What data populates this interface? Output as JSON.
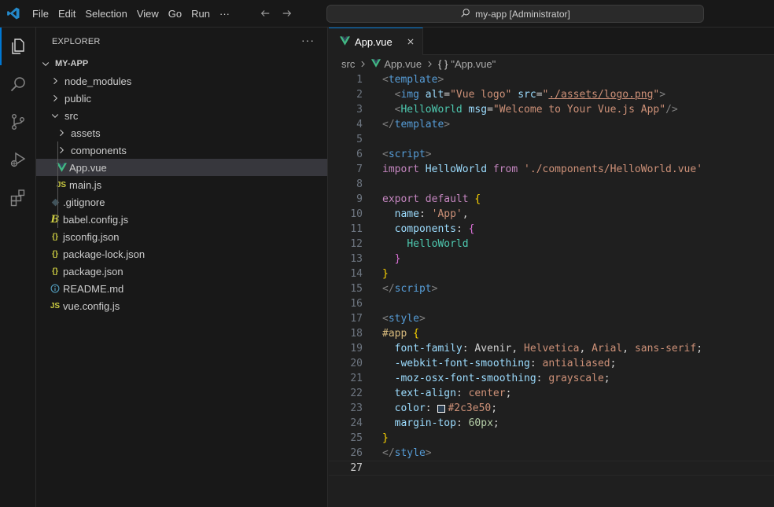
{
  "titlebar": {
    "menu": [
      "File",
      "Edit",
      "Selection",
      "View",
      "Go",
      "Run"
    ],
    "more": "···",
    "command_center": "my-app [Administrator]"
  },
  "sidebar": {
    "title": "EXPLORER",
    "more": "···",
    "project": "MY-APP",
    "items": [
      {
        "label": "node_modules",
        "type": "folder"
      },
      {
        "label": "public",
        "type": "folder"
      },
      {
        "label": "src",
        "type": "folder-open"
      },
      {
        "label": "assets",
        "type": "folder"
      },
      {
        "label": "components",
        "type": "folder"
      },
      {
        "label": "App.vue",
        "type": "vue"
      },
      {
        "label": "main.js",
        "type": "js"
      },
      {
        "label": ".gitignore",
        "type": "git"
      },
      {
        "label": "babel.config.js",
        "type": "babel"
      },
      {
        "label": "jsconfig.json",
        "type": "json"
      },
      {
        "label": "package-lock.json",
        "type": "json"
      },
      {
        "label": "package.json",
        "type": "json"
      },
      {
        "label": "README.md",
        "type": "info"
      },
      {
        "label": "vue.config.js",
        "type": "js"
      }
    ]
  },
  "editor": {
    "tab": "App.vue",
    "breadcrumb": [
      "src",
      "App.vue",
      "\"App.vue\""
    ],
    "line_numbers": [
      "1",
      "2",
      "3",
      "4",
      "5",
      "6",
      "7",
      "8",
      "9",
      "10",
      "11",
      "12",
      "13",
      "14",
      "15",
      "16",
      "17",
      "18",
      "19",
      "20",
      "21",
      "22",
      "23",
      "24",
      "25",
      "26",
      "27"
    ],
    "current_line": 27
  },
  "colors": {
    "accent": "#0078d4",
    "vue_green": "#41b883",
    "js_yellow": "#cbcb41",
    "json_yellow": "#cbcb41",
    "info_blue": "#519aba",
    "swatch": "#2c3e50"
  }
}
